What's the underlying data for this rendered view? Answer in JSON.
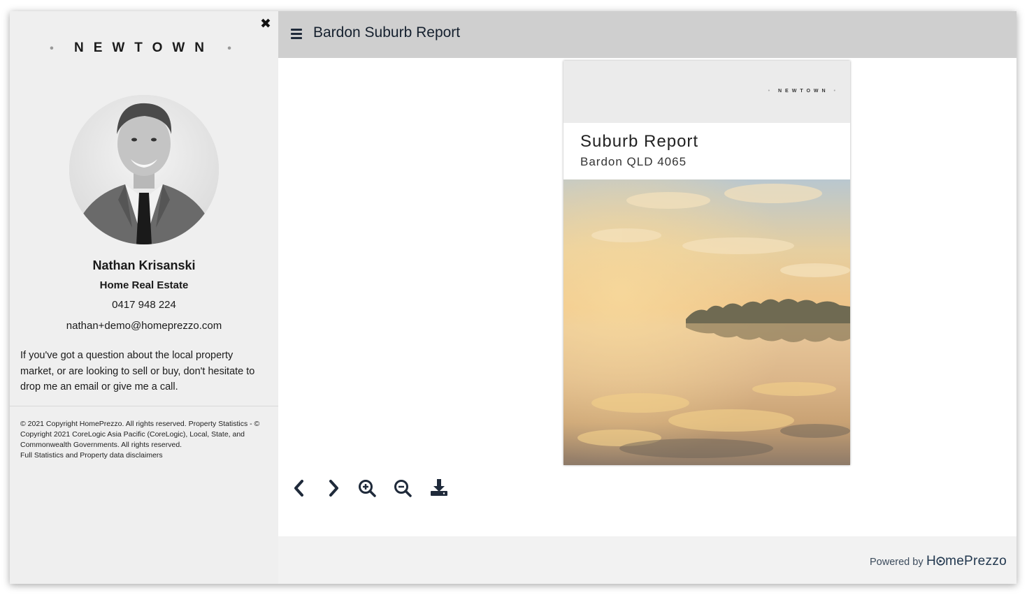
{
  "sidebar": {
    "close_label": "✖",
    "logo": "NEWTOWN",
    "logo_dot": "•",
    "agent": {
      "name": "Nathan Krisanski",
      "agency": "Home Real Estate",
      "phone": "0417 948 224",
      "email": "nathan+demo@homeprezzo.com"
    },
    "bio": "If you've got a question about the local property market, or are looking to sell or buy, don't hesitate to drop me an email or give me a call.",
    "copyright": "© 2021 Copyright HomePrezzo. All rights reserved. Property Statistics - © Copyright 2021 CoreLogic Asia Pacific (CoreLogic), Local, State, and Commonwealth Governments. All rights reserved.",
    "disclaimer_link": "Full Statistics and Property data disclaimers"
  },
  "header": {
    "title": "Bardon Suburb Report",
    "menu_icon": "hamburger-icon"
  },
  "report_page": {
    "logo": "NEWTOWN",
    "heading": "Suburb Report",
    "subheading": "Bardon QLD 4065"
  },
  "toolbar": {
    "icons": [
      "chevron-left-icon",
      "chevron-right-icon",
      "zoom-in-icon",
      "zoom-out-icon",
      "download-icon"
    ]
  },
  "footer": {
    "powered_prefix": "Powered by",
    "brand_h": "H",
    "brand_rest": "mePrezzo"
  },
  "colors": {
    "sidebar_bg": "#efefef",
    "header_bg": "#cfcfcf",
    "icon_color": "#1f2a3a"
  }
}
